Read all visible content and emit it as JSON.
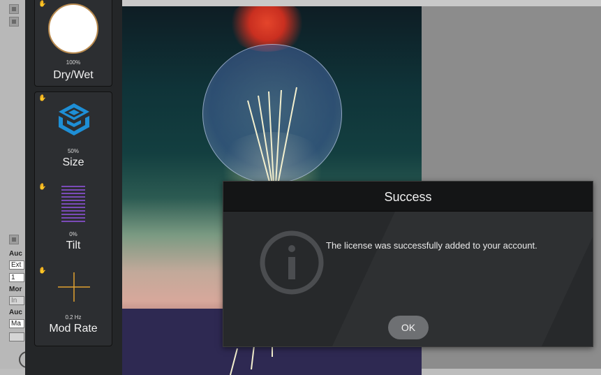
{
  "plugin": {
    "controls": [
      {
        "name": "Dry/Wet",
        "value": "100%"
      },
      {
        "name": "Size",
        "value": "50%"
      },
      {
        "name": "Tilt",
        "value": "0%"
      },
      {
        "name": "Mod Rate",
        "value": "0.2 Hz"
      }
    ]
  },
  "host": {
    "labels": [
      "Auc",
      "Mor",
      "Auc"
    ],
    "fields": [
      "Ext",
      "1",
      "In",
      "Ma"
    ]
  },
  "dialog": {
    "title": "Success",
    "message": "The license was successfully added to your account.",
    "ok_label": "OK",
    "icon": "info-icon"
  },
  "colors": {
    "accent_blue": "#1e8fd6",
    "accent_purple": "#7a4bb8",
    "accent_orange": "#e0a030",
    "knob_ring": "#b88a4f"
  }
}
